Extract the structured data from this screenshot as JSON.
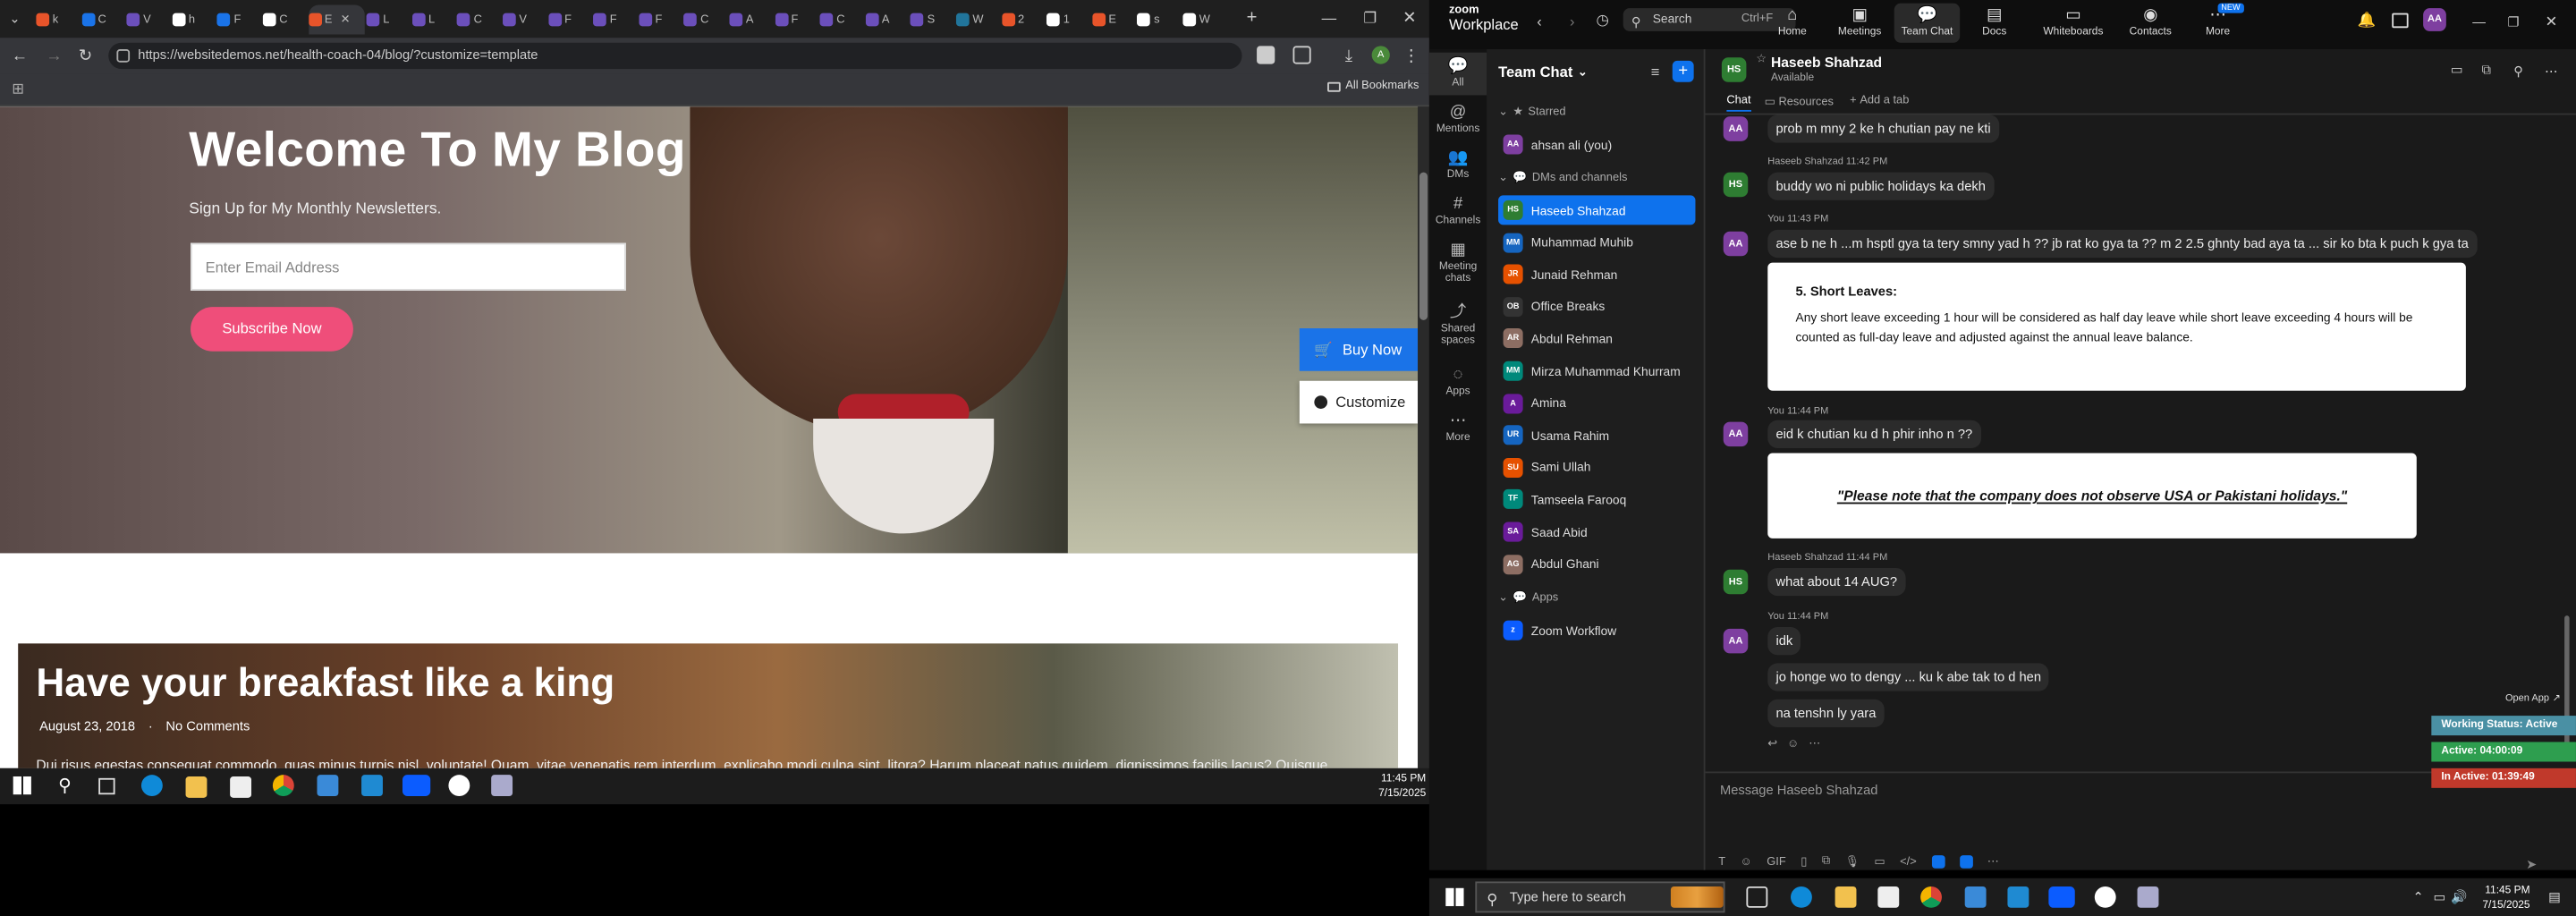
{
  "browser": {
    "url": "https://websitedemos.net/health-coach-04/blog/?customize=template",
    "all_bookmarks": "All Bookmarks",
    "tabs": [
      {
        "label": "k",
        "color": "#e8542a"
      },
      {
        "label": "C",
        "color": "#1a73e8"
      },
      {
        "label": "V",
        "color": "#6b4fbb"
      },
      {
        "label": "h",
        "color": "#ffffff"
      },
      {
        "label": "F",
        "color": "#1a73e8"
      },
      {
        "label": "C",
        "color": "#ffffff"
      },
      {
        "label": "E",
        "color": "#e8542a"
      },
      {
        "label": "L",
        "color": "#6b4fbb"
      },
      {
        "label": "L",
        "color": "#6b4fbb"
      },
      {
        "label": "C",
        "color": "#6b4fbb"
      },
      {
        "label": "V",
        "color": "#6b4fbb"
      },
      {
        "label": "F",
        "color": "#6b4fbb"
      },
      {
        "label": "F",
        "color": "#6b4fbb"
      },
      {
        "label": "F",
        "color": "#6b4fbb"
      },
      {
        "label": "C",
        "color": "#6b4fbb"
      },
      {
        "label": "A",
        "color": "#6b4fbb"
      },
      {
        "label": "F",
        "color": "#6b4fbb"
      },
      {
        "label": "C",
        "color": "#6b4fbb"
      },
      {
        "label": "A",
        "color": "#6b4fbb"
      },
      {
        "label": "S",
        "color": "#6b4fbb"
      },
      {
        "label": "W",
        "color": "#21759b"
      },
      {
        "label": "2",
        "color": "#e8542a"
      },
      {
        "label": "1",
        "color": "#ffffff"
      },
      {
        "label": "E",
        "color": "#e8542a"
      },
      {
        "label": "s",
        "color": "#ffffff"
      },
      {
        "label": "W",
        "color": "#ffffff"
      }
    ]
  },
  "webpage": {
    "hero_title": "Welcome To My Blog",
    "hero_subtitle": "Sign Up for My Monthly Newsletters.",
    "email_placeholder": "Enter Email Address",
    "subscribe_label": "Subscribe Now",
    "buy_now": "Buy Now",
    "customize": "Customize",
    "post_title": "Have your breakfast like a king",
    "post_date": "August 23, 2018",
    "post_comments": "No Comments",
    "post_excerpt": "Dui risus egestas consequat commodo, quas minus turpis nisl, voluptate! Quam, vitae venenatis rem interdum, explicabo modi culpa sint, litora? Harum placeat natus quidem, dignissimos facilis lacus? Quisque"
  },
  "taskbar_left": {
    "time": "11:45 PM",
    "date": "7/15/2025"
  },
  "zoom": {
    "brand_top": "zoom",
    "brand": "Workplace",
    "search": "Search",
    "search_shortcut": "Ctrl+F",
    "nav": [
      "Home",
      "Meetings",
      "Team Chat",
      "Docs",
      "Whiteboards",
      "Contacts",
      "More"
    ],
    "new_badge": "NEW",
    "user_initials": "AA",
    "rail": [
      "All",
      "Mentions",
      "DMs",
      "Channels",
      "Meeting chats",
      "Shared spaces",
      "Apps",
      "More"
    ],
    "sidebar_title": "Team Chat",
    "sections": {
      "starred": "Starred",
      "dms": "DMs and channels",
      "apps": "Apps"
    },
    "starred_item": "ahsan ali (you)",
    "contacts": [
      {
        "name": "Haseeb Shahzad",
        "initials": "HS",
        "color": "#2e7d32"
      },
      {
        "name": "Muhammad Muhib",
        "initials": "MM",
        "color": "#1565c0"
      },
      {
        "name": "Junaid Rehman",
        "initials": "JR",
        "color": "#e65100"
      },
      {
        "name": "Office Breaks",
        "initials": "OB",
        "color": "#333333"
      },
      {
        "name": "Abdul Rehman",
        "initials": "AR",
        "color": "#8d6e63"
      },
      {
        "name": "Mirza Muhammad Khurram",
        "initials": "MM",
        "color": "#00897b"
      },
      {
        "name": "Amina",
        "initials": "A",
        "color": "#6a1b9a"
      },
      {
        "name": "Usama Rahim",
        "initials": "UR",
        "color": "#1565c0"
      },
      {
        "name": "Sami Ullah",
        "initials": "SU",
        "color": "#e65100"
      },
      {
        "name": "Tamseela Farooq",
        "initials": "TF",
        "color": "#00897b"
      },
      {
        "name": "Saad Abid",
        "initials": "SA",
        "color": "#6a1b9a"
      },
      {
        "name": "Abdul Ghani",
        "initials": "AG",
        "color": "#8d6e63"
      }
    ],
    "app_item": "Zoom Workflow",
    "chat": {
      "name": "Haseeb Shahzad",
      "status": "Available",
      "tabs": [
        "Chat",
        "Resources",
        "Add a tab"
      ],
      "messages": {
        "m0": "prob m mny 2 ke h chutian pay ne kti",
        "meta1": "Haseeb Shahzad 11:42 PM",
        "m1": "buddy wo ni public holidays ka dekh",
        "meta2": "You 11:43 PM",
        "m2": "ase b ne h ...m hsptl gya ta tery smny yad h ?? jb rat ko gya ta ?? m 2 2.5 ghnty bad aya ta ... sir ko bta k puch k gya ta",
        "card1_title": "5. Short Leaves:",
        "card1_body": "Any short leave exceeding 1 hour will be considered as half day leave while short leave exceeding 4 hours will be counted as full-day leave and adjusted against the annual leave balance.",
        "meta3": "You 11:44 PM",
        "m3": "eid k chutian ku d h phir inho n ??",
        "card2": "\"Please note that the company does not observe USA or Pakistani holidays.\"",
        "meta4": "Haseeb Shahzad 11:44 PM",
        "m4": "what about 14 AUG?",
        "meta5": "You 11:44 PM",
        "m5": "idk",
        "m6": "jo honge wo to dengy ... ku k abe tak to d hen",
        "m7": "na tenshn ly yara"
      },
      "composer_placeholder": "Message Haseeb Shahzad"
    },
    "status_widget": {
      "open_app": "Open App",
      "working": "Working Status: Active",
      "active": "Active: 04:00:09",
      "inactive": "In Active: 01:39:49",
      "colors": {
        "working": "#4a90a4",
        "active": "#2e9e4f",
        "inactive": "#c0392b"
      }
    }
  },
  "taskbar_right": {
    "search_placeholder": "Type here to search",
    "time": "11:45 PM",
    "date": "7/15/2025"
  }
}
